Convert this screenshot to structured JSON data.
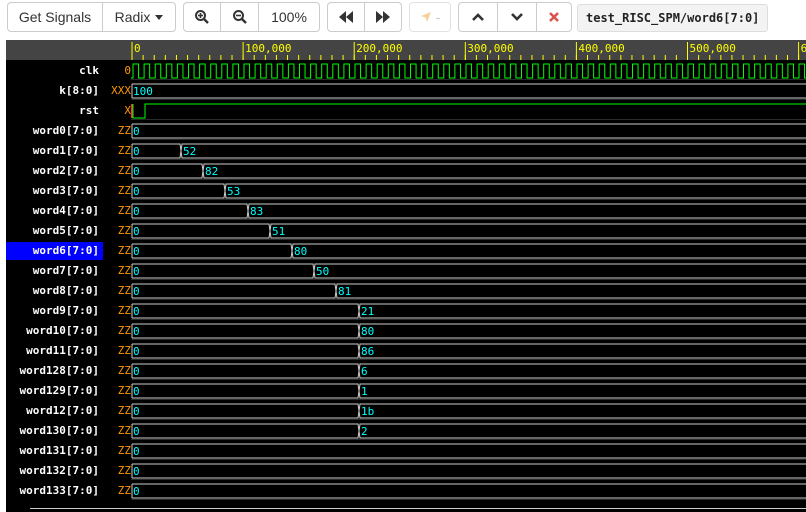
{
  "toolbar": {
    "get_signals_label": "Get Signals",
    "radix_label": "Radix",
    "zoom_label": "100%",
    "marker_label": "-",
    "path": "test_RISC_SPM/word6[7:0]"
  },
  "ruler": {
    "ticks": [
      "0",
      "100,000",
      "200,000",
      "300,000",
      "400,000",
      "500,000",
      "6"
    ]
  },
  "signals": [
    {
      "name": "clk",
      "value": "0",
      "kind": "clock"
    },
    {
      "name": "k[8:0]",
      "value": "XXX",
      "kind": "bus",
      "segments": [
        "100"
      ]
    },
    {
      "name": "rst",
      "value": "X",
      "kind": "bit"
    },
    {
      "name": "word0[7:0]",
      "value": "ZZ",
      "kind": "bus",
      "segments": [
        "0"
      ]
    },
    {
      "name": "word1[7:0]",
      "value": "ZZ",
      "kind": "bus",
      "segments": [
        "0",
        "52"
      ]
    },
    {
      "name": "word2[7:0]",
      "value": "ZZ",
      "kind": "bus",
      "segments": [
        "0",
        "82"
      ]
    },
    {
      "name": "word3[7:0]",
      "value": "ZZ",
      "kind": "bus",
      "segments": [
        "0",
        "53"
      ]
    },
    {
      "name": "word4[7:0]",
      "value": "ZZ",
      "kind": "bus",
      "segments": [
        "0",
        "83"
      ]
    },
    {
      "name": "word5[7:0]",
      "value": "ZZ",
      "kind": "bus",
      "segments": [
        "0",
        "51"
      ]
    },
    {
      "name": "word6[7:0]",
      "value": "ZZ",
      "kind": "bus",
      "segments": [
        "0",
        "80"
      ],
      "selected": true
    },
    {
      "name": "word7[7:0]",
      "value": "ZZ",
      "kind": "bus",
      "segments": [
        "0",
        "50"
      ]
    },
    {
      "name": "word8[7:0]",
      "value": "ZZ",
      "kind": "bus",
      "segments": [
        "0",
        "81"
      ]
    },
    {
      "name": "word9[7:0]",
      "value": "ZZ",
      "kind": "bus",
      "segments": [
        "0",
        "21"
      ]
    },
    {
      "name": "word10[7:0]",
      "value": "ZZ",
      "kind": "bus",
      "segments": [
        "0",
        "80"
      ]
    },
    {
      "name": "word11[7:0]",
      "value": "ZZ",
      "kind": "bus",
      "segments": [
        "0",
        "86"
      ]
    },
    {
      "name": "word128[7:0]",
      "value": "ZZ",
      "kind": "bus",
      "segments": [
        "0",
        "6"
      ]
    },
    {
      "name": "word129[7:0]",
      "value": "ZZ",
      "kind": "bus",
      "segments": [
        "0",
        "1"
      ]
    },
    {
      "name": "word12[7:0]",
      "value": "ZZ",
      "kind": "bus",
      "segments": [
        "0",
        "1b"
      ]
    },
    {
      "name": "word130[7:0]",
      "value": "ZZ",
      "kind": "bus",
      "segments": [
        "0",
        "2"
      ]
    },
    {
      "name": "word131[7:0]",
      "value": "ZZ",
      "kind": "bus",
      "segments": [
        "0"
      ]
    },
    {
      "name": "word132[7:0]",
      "value": "ZZ",
      "kind": "bus",
      "segments": [
        "0"
      ]
    },
    {
      "name": "word133[7:0]",
      "value": "ZZ",
      "kind": "bus",
      "segments": [
        "0"
      ]
    }
  ],
  "colors": {
    "wave": "#00ff00",
    "bus_text": "#00ffff",
    "name_text": "#ffffff",
    "value_text": "#ff9900",
    "selected": "#0000ff",
    "ruler_bg": "#444444",
    "ruler_text": "#ffff00"
  }
}
